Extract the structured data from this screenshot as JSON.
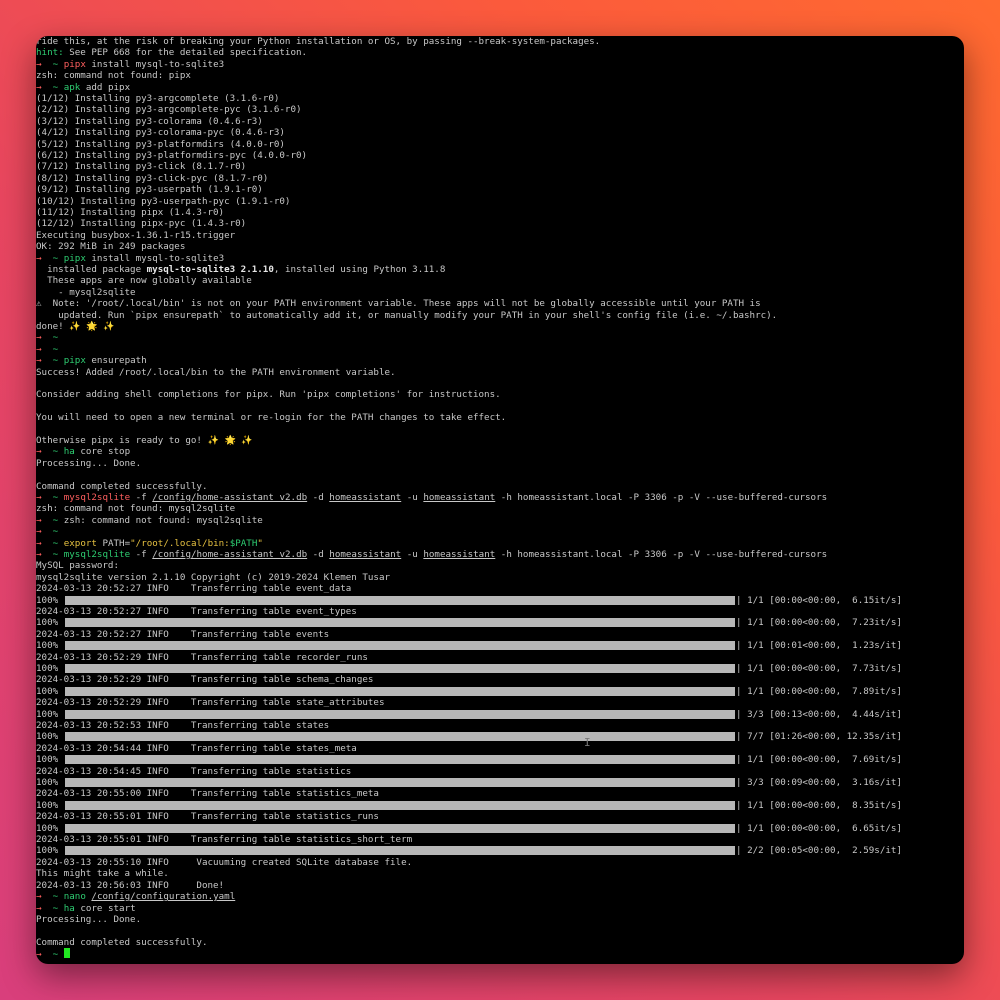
{
  "terminal": {
    "prompt_arrow": "→",
    "prompt_home": "~",
    "lines": {
      "l0": "ride this, at the risk of breaking your Python installation or OS, by passing --break-system-packages.",
      "l1_hint": "hint:",
      "l1_rest": " See PEP 668 for the detailed specification.",
      "l2_cmd": "pipx",
      "l2_args": " install mysql-to-sqlite3",
      "l3": "zsh: command not found: pipx",
      "l4_cmd": "apk",
      "l4_args": " add pipx",
      "l5": "(1/12) Installing py3-argcomplete (3.1.6-r0)",
      "l6": "(2/12) Installing py3-argcomplete-pyc (3.1.6-r0)",
      "l7": "(3/12) Installing py3-colorama (0.4.6-r3)",
      "l8": "(4/12) Installing py3-colorama-pyc (0.4.6-r3)",
      "l9": "(5/12) Installing py3-platformdirs (4.0.0-r0)",
      "l10": "(6/12) Installing py3-platformdirs-pyc (4.0.0-r0)",
      "l11": "(7/12) Installing py3-click (8.1.7-r0)",
      "l12": "(8/12) Installing py3-click-pyc (8.1.7-r0)",
      "l13": "(9/12) Installing py3-userpath (1.9.1-r0)",
      "l14": "(10/12) Installing py3-userpath-pyc (1.9.1-r0)",
      "l15": "(11/12) Installing pipx (1.4.3-r0)",
      "l16": "(12/12) Installing pipx-pyc (1.4.3-r0)",
      "l17": "Executing busybox-1.36.1-r15.trigger",
      "l18": "OK: 292 MiB in 249 packages",
      "l19_cmd": "pipx",
      "l19_args": " install mysql-to-sqlite3",
      "l20_a": "  installed package ",
      "l20_pkg": "mysql-to-sqlite3 2.1.10",
      "l20_b": ", installed using Python 3.11.8",
      "l21": "  These apps are now globally available",
      "l22": "    - mysql2sqlite",
      "l23": "⚠  Note: '/root/.local/bin' is not on your PATH environment variable. These apps will not be globally accessible until your PATH is",
      "l24": "    updated. Run `pipx ensurepath` to automatically add it, or manually modify your PATH in your shell's config file (i.e. ~/.bashrc).",
      "l25": "done! ✨ 🌟 ✨",
      "l29_cmd": "pipx",
      "l29_args": " ensurepath",
      "l30": "Success! Added /root/.local/bin to the PATH environment variable.",
      "l32": "Consider adding shell completions for pipx. Run 'pipx completions' for instructions.",
      "l34": "You will need to open a new terminal or re-login for the PATH changes to take effect.",
      "l36": "Otherwise pipx is ready to go! ✨ 🌟 ✨",
      "l37_cmd": "ha",
      "l37_args": " core stop",
      "l38": "Processing... Done.",
      "l40": "Command completed successfully.",
      "m_cmd": "mysql2sqlite",
      "m_f": " -f ",
      "m_path": "/config/home-assistant_v2.db",
      "m_d": " -d ",
      "m_db": "homeassistant",
      "m_u": " -u ",
      "m_user": "homeassistant",
      "m_rest": " -h homeassistant.local -P 3306 -p -V --use-buffered-cursors",
      "l42": "zsh: command not found: mysql2sqlite",
      "l43": " zsh: command not found: mysql2sqlite",
      "l46_cmd": "export",
      "l46_a": " PATH=",
      "l46_b": "\"/root/.local/bin:",
      "l46_c": "$PATH",
      "l46_d": "\"",
      "l48": "MySQL password:",
      "l49": "mysql2sqlite version 2.1.10 Copyright (c) 2019-2024 Klemen Tusar",
      "t_info": "INFO",
      "t_msg": "    Transferring table ",
      "l78": "2024-03-13 20:55:10 INFO     Vacuuming created SQLite database file.",
      "l79": "This might take a while.",
      "l80": "2024-03-13 20:56:03 INFO     Done!",
      "l81_cmd": "nano",
      "l81_path": "/config/configuration.yaml",
      "l82_cmd": "ha",
      "l82_args": " core start",
      "l83": "Processing... Done.",
      "l85": "Command completed successfully."
    },
    "transfers": [
      {
        "ts": "2024-03-13 20:52:27",
        "table": "event_data",
        "pct": "100%",
        "stats": "| 1/1 [00:00<00:00,  6.15it/s]",
        "progress": 1.0
      },
      {
        "ts": "2024-03-13 20:52:27",
        "table": "event_types",
        "pct": "100%",
        "stats": "| 1/1 [00:00<00:00,  7.23it/s]",
        "progress": 1.0
      },
      {
        "ts": "2024-03-13 20:52:27",
        "table": "events",
        "pct": "100%",
        "stats": "| 1/1 [00:01<00:00,  1.23s/it]",
        "progress": 1.0
      },
      {
        "ts": "2024-03-13 20:52:29",
        "table": "recorder_runs",
        "pct": "100%",
        "stats": "| 1/1 [00:00<00:00,  7.73it/s]",
        "progress": 1.0
      },
      {
        "ts": "2024-03-13 20:52:29",
        "table": "schema_changes",
        "pct": "100%",
        "stats": "| 1/1 [00:00<00:00,  7.89it/s]",
        "progress": 1.0
      },
      {
        "ts": "2024-03-13 20:52:29",
        "table": "state_attributes",
        "pct": "100%",
        "stats": "| 3/3 [00:13<00:00,  4.44s/it]",
        "progress": 1.0
      },
      {
        "ts": "2024-03-13 20:52:53",
        "table": "states",
        "pct": "100%",
        "stats": "| 7/7 [01:26<00:00, 12.35s/it]",
        "progress": 1.0
      },
      {
        "ts": "2024-03-13 20:54:44",
        "table": "states_meta",
        "pct": "100%",
        "stats": "| 1/1 [00:00<00:00,  7.69it/s]",
        "progress": 1.0
      },
      {
        "ts": "2024-03-13 20:54:45",
        "table": "statistics",
        "pct": "100%",
        "stats": "| 3/3 [00:09<00:00,  3.16s/it]",
        "progress": 1.0
      },
      {
        "ts": "2024-03-13 20:55:00",
        "table": "statistics_meta",
        "pct": "100%",
        "stats": "| 1/1 [00:00<00:00,  8.35it/s]",
        "progress": 1.0
      },
      {
        "ts": "2024-03-13 20:55:01",
        "table": "statistics_runs",
        "pct": "100%",
        "stats": "| 1/1 [00:00<00:00,  6.65it/s]",
        "progress": 1.0
      },
      {
        "ts": "2024-03-13 20:55:01",
        "table": "statistics_short_term",
        "pct": "100%",
        "stats": "| 2/2 [00:05<00:00,  2.59s/it]",
        "progress": 1.0
      }
    ]
  },
  "colors": {
    "prompt_green": "#2ecc71",
    "command_red": "#ff5f5f",
    "string_yellow": "#e5c040",
    "progress_bar": "#b7b7b7",
    "cursor": "#22e622"
  }
}
